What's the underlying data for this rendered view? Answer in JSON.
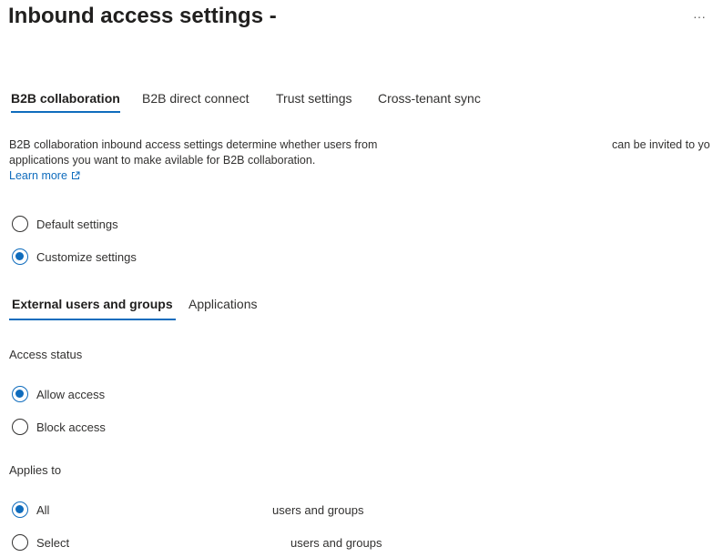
{
  "header": {
    "title": "Inbound access settings -",
    "more_label": "···"
  },
  "tabs": [
    {
      "label": "B2B collaboration",
      "active": true
    },
    {
      "label": "B2B direct connect",
      "active": false
    },
    {
      "label": "Trust settings",
      "active": false
    },
    {
      "label": "Cross-tenant sync",
      "active": false
    }
  ],
  "description": {
    "line1_left": "B2B collaboration inbound access settings determine whether users from",
    "line1_right": "can be invited to yo",
    "line2": "applications you want to make avilable for B2B collaboration.",
    "learn_more": "Learn more"
  },
  "settings_mode": {
    "options": [
      {
        "label": "Default settings",
        "checked": false
      },
      {
        "label": "Customize settings",
        "checked": true
      }
    ]
  },
  "subtabs": [
    {
      "label": "External users and groups",
      "active": true
    },
    {
      "label": "Applications",
      "active": false
    }
  ],
  "access_status": {
    "label": "Access status",
    "options": [
      {
        "label": "Allow access",
        "checked": true
      },
      {
        "label": "Block access",
        "checked": false
      }
    ]
  },
  "applies_to": {
    "label": "Applies to",
    "options": [
      {
        "label": "All",
        "suffix": "users and groups",
        "checked": true
      },
      {
        "label": "Select",
        "suffix": "users and groups",
        "checked": false
      }
    ]
  },
  "colors": {
    "accent": "#0f6cbd",
    "text": "#323130"
  }
}
